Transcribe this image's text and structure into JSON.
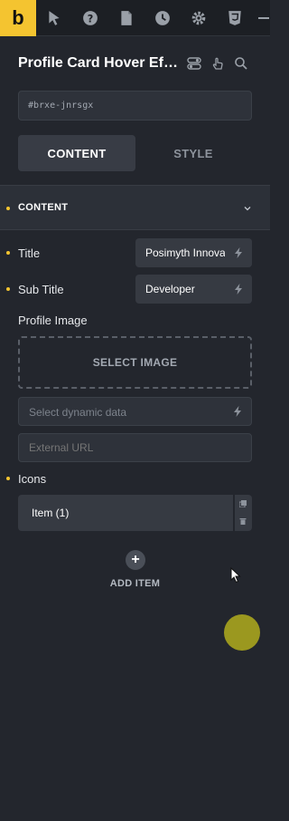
{
  "toolbar": {
    "logo": "b",
    "icons": [
      "cursor-icon",
      "help-icon",
      "page-icon",
      "history-icon",
      "settings-icon",
      "css3-icon",
      "menu-icon"
    ]
  },
  "element": {
    "title": "Profile Card Hover Eff...",
    "id": "#brxe-jnrsgx"
  },
  "tabs": [
    {
      "label": "CONTENT",
      "active": true
    },
    {
      "label": "STYLE",
      "active": false
    }
  ],
  "section": {
    "title": "CONTENT"
  },
  "controls": {
    "title": {
      "label": "Title",
      "value": "Posimyth Innovation"
    },
    "subtitle": {
      "label": "Sub Title",
      "value": "Developer"
    },
    "profile_image": {
      "label": "Profile Image",
      "select_label": "SELECT IMAGE",
      "dynamic_placeholder": "Select dynamic data",
      "url_placeholder": "External URL"
    },
    "icons": {
      "label": "Icons",
      "items": [
        "Item (1)"
      ],
      "add_label": "ADD ITEM",
      "add_symbol": "+"
    }
  },
  "colors": {
    "accent": "#f4c430",
    "panel_bg": "#23262d",
    "input_bg": "#363a42",
    "click_marker": "#a6a21e"
  }
}
